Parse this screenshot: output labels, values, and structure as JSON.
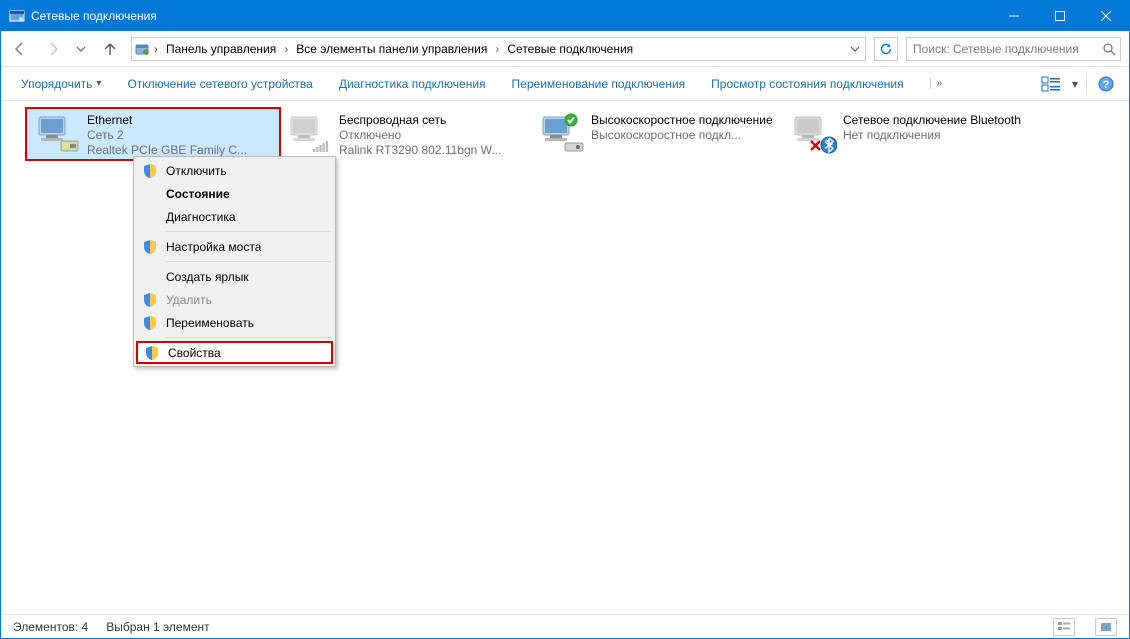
{
  "window": {
    "title": "Сетевые подключения"
  },
  "breadcrumbs": {
    "item0": "Панель управления",
    "item1": "Все элементы панели управления",
    "item2": "Сетевые подключения"
  },
  "search": {
    "placeholder": "Поиск: Сетевые подключения"
  },
  "commands": {
    "organize": "Упорядочить",
    "disable": "Отключение сетевого устройства",
    "diagnose": "Диагностика подключения",
    "rename": "Переименование подключения",
    "status": "Просмотр состояния подключения"
  },
  "connections": {
    "c0_name": "Ethernet",
    "c0_l2": "Сеть  2",
    "c0_l3": "Realtek PCIe GBE Family C...",
    "c1_name": "Беспроводная сеть",
    "c1_l2": "Отключено",
    "c1_l3": "Ralink RT3290 802.11bgn W...",
    "c2_name": "Высокоскоростное подключение",
    "c2_l2": "",
    "c2_l3": "Высокоскоростное подкл...",
    "c3_name": "Сетевое подключение Bluetooth",
    "c3_l2": "",
    "c3_l3": "Нет подключения"
  },
  "context_menu": {
    "disable": "Отключить",
    "status": "Состояние",
    "diagnose": "Диагностика",
    "bridge": "Настройка моста",
    "shortcut": "Создать ярлык",
    "delete": "Удалить",
    "rename": "Переименовать",
    "properties": "Свойства"
  },
  "status_bar": {
    "count": "Элементов: 4",
    "selection": "Выбран 1 элемент"
  }
}
